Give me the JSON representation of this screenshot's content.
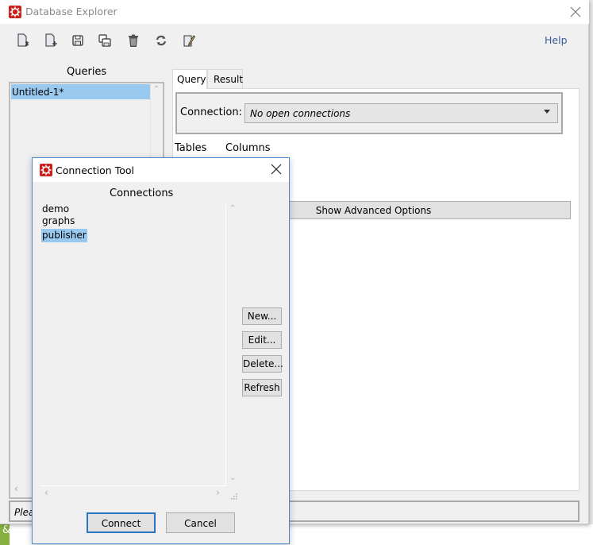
{
  "main_window": {
    "title": "Database Explorer",
    "toolbar": {
      "buttons": [
        {
          "icon": "new-query-icon"
        },
        {
          "icon": "add-query-icon"
        },
        {
          "icon": "save-icon"
        },
        {
          "icon": "save-all-icon"
        },
        {
          "icon": "trash-icon"
        },
        {
          "icon": "refresh-icon"
        },
        {
          "icon": "edit-icon"
        }
      ],
      "help_label": "Help"
    },
    "queries": {
      "label": "Queries",
      "items": [
        {
          "label": "Untitled-1*",
          "selected": true
        }
      ]
    },
    "tabs": [
      {
        "label": "Query",
        "active": true
      },
      {
        "label": "Result",
        "active": false
      }
    ],
    "connection": {
      "label": "Connection:",
      "selected_value": "No open connections"
    },
    "tables_label": "Tables",
    "columns_label": "Columns",
    "advanced_button_label": "Show Advanced Options",
    "status_text": "Plea"
  },
  "dialog": {
    "title": "Connection Tool",
    "connections_label": "Connections",
    "connections": [
      {
        "label": "demo",
        "selected": false
      },
      {
        "label": "graphs",
        "selected": false
      },
      {
        "label": "publisher",
        "selected": true
      }
    ],
    "side_buttons": {
      "new": "New...",
      "edit": "Edit...",
      "delete": "Delete...",
      "refresh": "Refresh"
    },
    "connect_label": "Connect",
    "cancel_label": "Cancel"
  },
  "background": {
    "left_glyph": "&"
  },
  "colors": {
    "app_icon": "#c8221f",
    "selection": "#99c9ef",
    "focus_border": "#2a73c0",
    "help_link": "#3a5a9c"
  }
}
